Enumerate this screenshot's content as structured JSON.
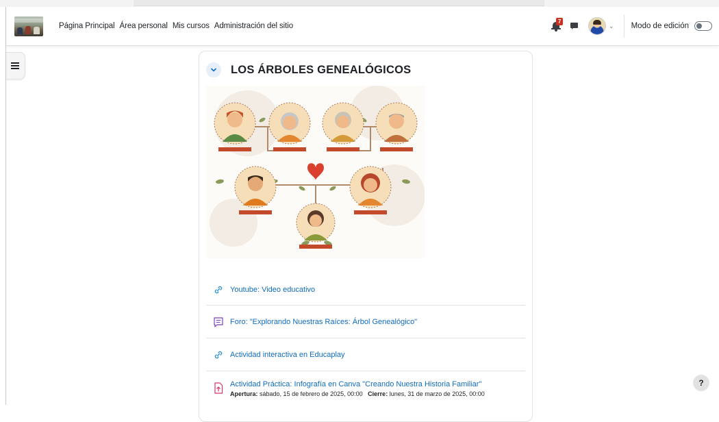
{
  "nav": {
    "links": [
      "Página Principal",
      "Área personal",
      "Mis cursos",
      "Administración del sitio"
    ],
    "notification_count": "7",
    "edit_mode_label": "Modo de edición"
  },
  "section": {
    "title": "LOS ÁRBOLES GENEALÓGICOS"
  },
  "activities": [
    {
      "type": "url",
      "icon": "link-icon",
      "name": "Youtube: Video educativo"
    },
    {
      "type": "forum",
      "icon": "forum-icon",
      "name": "Foro: \"Explorando Nuestras Raíces: Árbol Genealógico\""
    },
    {
      "type": "url",
      "icon": "link-icon",
      "name": "Actividad interactiva en Educaplay"
    },
    {
      "type": "assignment",
      "icon": "assignment-icon",
      "name": "Actividad Práctica: Infografía en Canva \"Creando Nuestra Historia Familiar\"",
      "open_label": "Apertura:",
      "open_value": "sábado, 15 de febrero de 2025, 00:00",
      "close_label": "Cierre:",
      "close_value": "lunes, 31 de marzo de 2025, 00:00"
    }
  ],
  "help_label": "?",
  "colors": {
    "link": "#0f6cbf",
    "url_icon": "#2a8fd6",
    "forum_icon": "#7b3fb8",
    "assignment_icon": "#d6336c",
    "badge": "#ca3120"
  }
}
